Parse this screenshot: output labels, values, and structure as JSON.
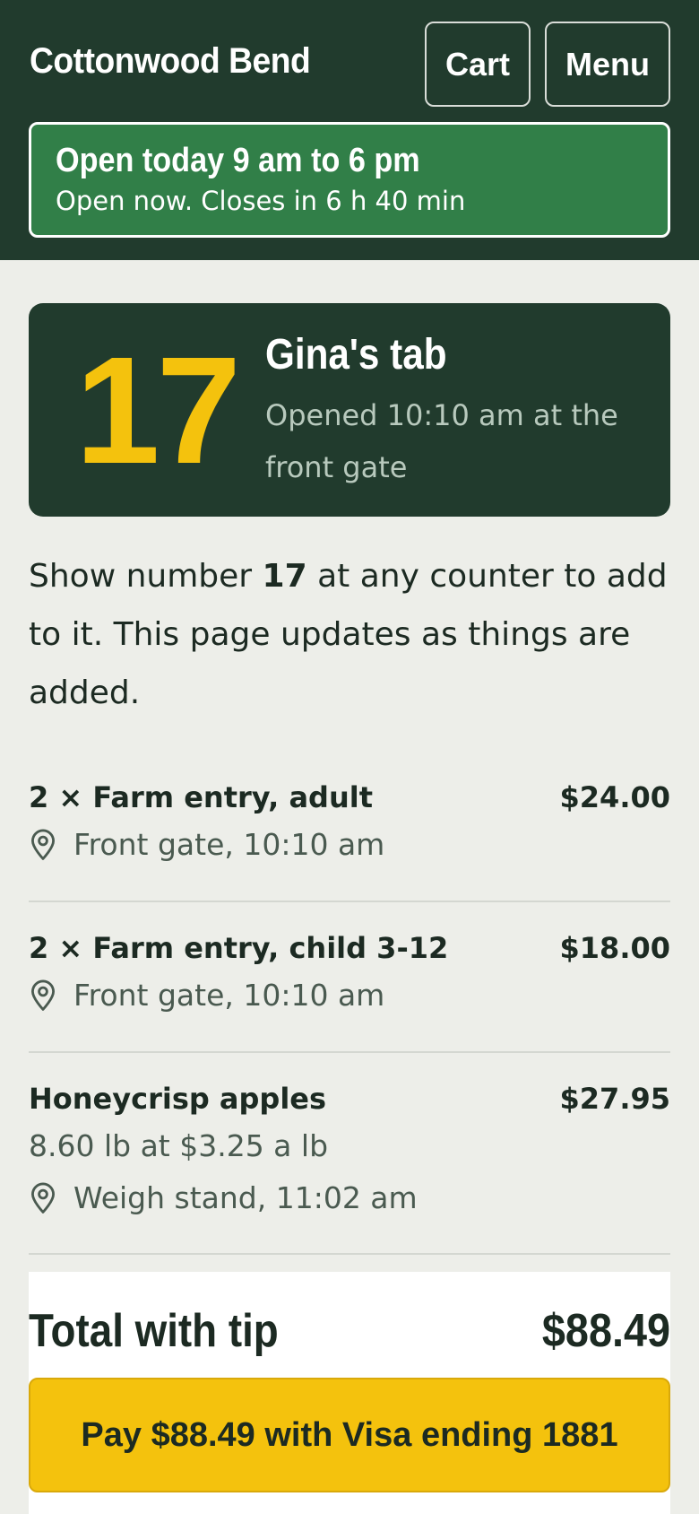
{
  "header": {
    "brand": "Cottonwood Bend",
    "cart_label": "Cart",
    "menu_label": "Menu"
  },
  "hours": {
    "title": "Open today 9 am to 6 pm",
    "status": "Open now. Closes in 6 h 40 min"
  },
  "tab": {
    "number": "17",
    "name": "Gina's tab",
    "opened": "Opened 10:10 am at the front gate"
  },
  "intro": {
    "before": "Show number ",
    "number": "17",
    "after": " at any counter to add to it. This page updates as things are added."
  },
  "items": [
    {
      "name": "2 × Farm entry, adult",
      "price": "$24.00",
      "location": "Front gate, 10:10 am"
    },
    {
      "name": "2 × Farm entry, child 3-12",
      "price": "$18.00",
      "location": "Front gate, 10:10 am"
    },
    {
      "name": "Honeycrisp apples",
      "price": "$27.95",
      "detail": "8.60 lb at $3.25 a lb",
      "location": "Weigh stand, 11:02 am"
    }
  ],
  "total": {
    "label": "Total with tip",
    "value": "$88.49"
  },
  "pay_button": "Pay $88.49 with Visa ending 1881",
  "icons": {
    "location": "location-pin-icon"
  },
  "colors": {
    "header_bg": "#213b2d",
    "open_bg": "#317f48",
    "accent": "#f4c20d",
    "page_bg": "#edeee9"
  }
}
